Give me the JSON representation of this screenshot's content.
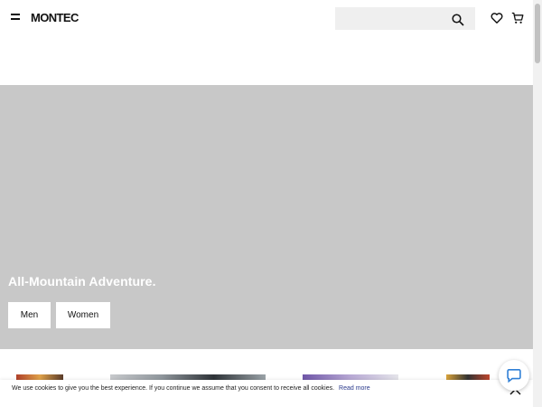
{
  "header": {
    "logo": "MONTEC",
    "search": {
      "value": "",
      "placeholder": ""
    },
    "icons": [
      "menu-icon",
      "search-icon",
      "heart-icon",
      "cart-icon"
    ]
  },
  "hero": {
    "title": "All-Mountain Adventure.",
    "buttons": {
      "men": "Men",
      "women": "Women"
    },
    "background_color": "#c8c8c8"
  },
  "cookie": {
    "text": "We use cookies to give you the best experience. If you continue we assume that you consent to receive all cookies.",
    "link": "Read more"
  },
  "colors": {
    "accent_link": "#2b3a8c"
  }
}
